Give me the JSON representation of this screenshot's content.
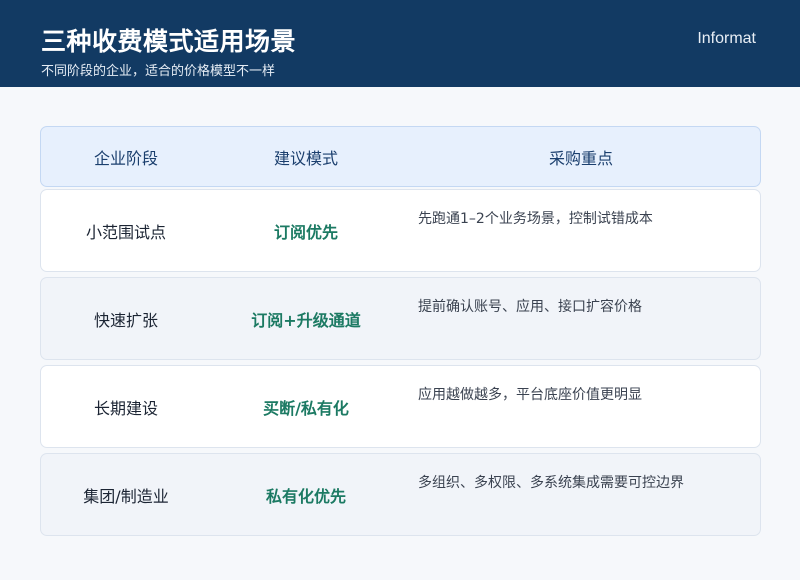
{
  "header": {
    "title": "三种收费模式适用场景",
    "subtitle": "不同阶段的企业，适合的价格模型不一样",
    "brand": "Informat"
  },
  "table": {
    "columns": [
      "企业阶段",
      "建议模式",
      "采购重点"
    ],
    "rows": [
      {
        "stage": "小范围试点",
        "mode": "订阅优先",
        "focus": "先跑通1–2个业务场景，控制试错成本"
      },
      {
        "stage": "快速扩张",
        "mode": "订阅+升级通道",
        "focus": "提前确认账号、应用、接口扩容价格"
      },
      {
        "stage": "长期建设",
        "mode": "买断/私有化",
        "focus": "应用越做越多，平台底座价值更明显"
      },
      {
        "stage": "集团/制造业",
        "mode": "私有化优先",
        "focus": "多组织、多权限、多系统集成需要可控边界"
      }
    ]
  }
}
